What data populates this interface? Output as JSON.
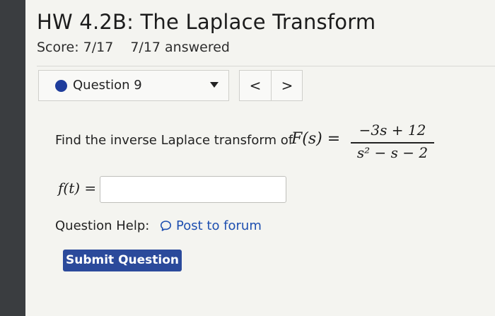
{
  "assignment": {
    "title": "HW 4.2B: The Laplace Transform",
    "score": "Score: 7/17",
    "answered": "7/17 answered"
  },
  "question_nav": {
    "selected": "Question 9",
    "prev_glyph": "<",
    "next_glyph": ">"
  },
  "question": {
    "prompt": "Find the inverse Laplace transform of",
    "function_lhs": "F(s) =",
    "numerator": "−3s + 12",
    "denominator": "s² − s − 2",
    "answer_label": "f(t) =",
    "answer_value": ""
  },
  "help": {
    "label": "Question Help:",
    "forum_link": "Post to forum",
    "forum_icon": "speech-bubble-icon"
  },
  "actions": {
    "submit_label": "Submit Question"
  },
  "colors": {
    "accent": "#2b4a9b",
    "link": "#1e4fb0",
    "indicator_dot": "#1f3d9c"
  }
}
